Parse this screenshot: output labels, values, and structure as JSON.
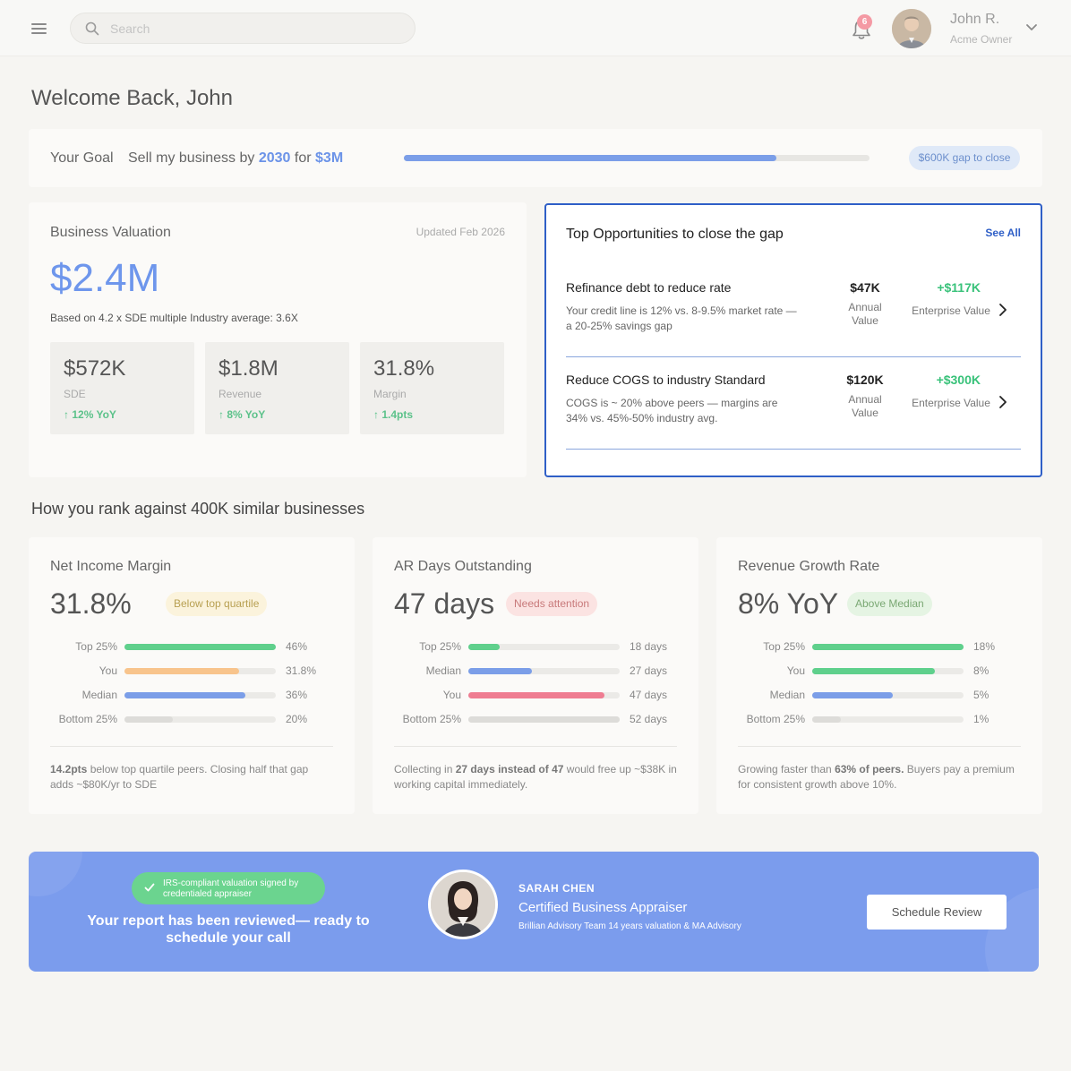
{
  "header": {
    "search_placeholder": "Search",
    "notification_count": "6",
    "user_name": "John R.",
    "user_role": "Acme Owner"
  },
  "welcome": "Welcome Back, John",
  "goal": {
    "label": "Your Goal",
    "text_prefix": "Sell my business by",
    "year": "2030",
    "text_mid": "for",
    "amount": "$3M",
    "progress": 0.8,
    "gap": "$600K gap to close"
  },
  "valuation": {
    "title": "Business Valuation",
    "updated": "Updated Feb 2026",
    "amount": "$2.4M",
    "note": "Based on 4.2 x SDE multiple Industry average: 3.6X",
    "stats": [
      {
        "value": "$572K",
        "label": "SDE",
        "delta": "12% YoY"
      },
      {
        "value": "$1.8M",
        "label": "Revenue",
        "delta": "8% YoY"
      },
      {
        "value": "31.8%",
        "label": "Margin",
        "delta": "1.4pts"
      }
    ]
  },
  "opportunities": {
    "title": "Top Opportunities to close the gap",
    "see_all": "See All",
    "items": [
      {
        "name": "Refinance debt to reduce rate",
        "desc": "Your credit line is 12% vs. 8-9.5% market rate — a 20-25% savings gap",
        "annual": "$47K",
        "annual_label": "Annual Value",
        "enterprise": "+$117K",
        "enterprise_label": "Enterprise Value"
      },
      {
        "name": "Reduce COGS to industry Standard",
        "desc": "COGS is ~ 20% above peers — margins are 34% vs. 45%-50% industry avg.",
        "annual": "$120K",
        "annual_label": "Annual Value",
        "enterprise": "+$300K",
        "enterprise_label": "Enterprise Value"
      }
    ]
  },
  "rank": {
    "heading": "How you rank against 400K similar businesses",
    "cards": [
      {
        "title": "Net Income Margin",
        "value": "31.8%",
        "badge": "Below top quartile",
        "rows": [
          {
            "label": "Top 25%",
            "value": "46%",
            "fill": 1.0,
            "color": "#5fd08c"
          },
          {
            "label": "You",
            "value": "31.8%",
            "fill": 0.76,
            "color": "#f8c48c"
          },
          {
            "label": "Median",
            "value": "36%",
            "fill": 0.8,
            "color": "#7b9ee8"
          },
          {
            "label": "Bottom 25%",
            "value": "20%",
            "fill": 0.32,
            "color": "#dddcd9"
          }
        ],
        "note_bold": "14.2pts",
        "note": " below top quartile peers. Closing half that gap adds ~$80K/yr to SDE"
      },
      {
        "title": "AR Days Outstanding",
        "value": "47 days",
        "badge": "Needs attention",
        "rows": [
          {
            "label": "Top 25%",
            "value": "18 days",
            "fill": 0.21,
            "color": "#5fd08c"
          },
          {
            "label": "Median",
            "value": "27 days",
            "fill": 0.42,
            "color": "#7b9ee8"
          },
          {
            "label": "You",
            "value": "47 days",
            "fill": 0.9,
            "color": "#ef7d92"
          },
          {
            "label": "Bottom 25%",
            "value": "52 days",
            "fill": 1.0,
            "color": "#dddcd9"
          }
        ],
        "note_pre": "Collecting in ",
        "note_bold": "27 days instead of 47",
        "note": " would free up ~$38K in working capital immediately."
      },
      {
        "title": "Revenue Growth Rate",
        "value": "8% YoY",
        "badge": "Above Median",
        "rows": [
          {
            "label": "Top 25%",
            "value": "18%",
            "fill": 1.0,
            "color": "#5fd08c"
          },
          {
            "label": "You",
            "value": "8%",
            "fill": 0.81,
            "color": "#5fd08c"
          },
          {
            "label": "Median",
            "value": "5%",
            "fill": 0.53,
            "color": "#7b9ee8"
          },
          {
            "label": "Bottom 25%",
            "value": "1%",
            "fill": 0.19,
            "color": "#dddcd9"
          }
        ],
        "note_pre": "Growing faster than ",
        "note_bold": "63% of peers.",
        "note": " Buyers pay a premium for consistent growth above 10%."
      }
    ]
  },
  "banner": {
    "irs_text": "IRS-compliant valuation signed by credentialed appraiser",
    "headline": "Your report has been reviewed— ready to schedule your call",
    "appraiser_name": "SARAH CHEN",
    "appraiser_title": "Certified Business Appraiser",
    "appraiser_desc": "Brillian Advisory Team 14 years valuation & MA Advisory",
    "button": "Schedule Review"
  }
}
